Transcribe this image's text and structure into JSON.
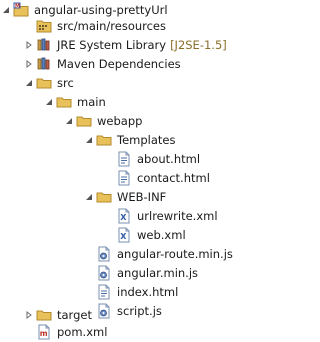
{
  "project_explorer": {
    "project": {
      "label": "angular-using-prettyUrl",
      "icon": "maven-project-icon"
    },
    "items": [
      {
        "label": "src/main/resources",
        "icon": "source-folder-icon",
        "arrow": "none"
      },
      {
        "label": "JRE System Library",
        "decoration": "[J2SE-1.5]",
        "icon": "library-icon",
        "arrow": "collapsed"
      },
      {
        "label": "Maven Dependencies",
        "icon": "library-icon",
        "arrow": "collapsed"
      },
      {
        "label": "src",
        "icon": "folder-icon",
        "arrow": "expanded"
      },
      {
        "label": "main",
        "icon": "folder-icon",
        "arrow": "expanded"
      },
      {
        "label": "webapp",
        "icon": "folder-icon",
        "arrow": "expanded"
      },
      {
        "label": "Templates",
        "icon": "folder-icon",
        "arrow": "expanded"
      },
      {
        "label": "about.html",
        "icon": "html-file-icon",
        "arrow": "none"
      },
      {
        "label": "contact.html",
        "icon": "html-file-icon",
        "arrow": "none"
      },
      {
        "label": "WEB-INF",
        "icon": "folder-icon",
        "arrow": "expanded"
      },
      {
        "label": "urlrewrite.xml",
        "icon": "xml-file-icon",
        "arrow": "none"
      },
      {
        "label": "web.xml",
        "icon": "xml-file-icon",
        "arrow": "none"
      },
      {
        "label": "angular-route.min.js",
        "icon": "js-file-icon",
        "arrow": "none"
      },
      {
        "label": "angular.min.js",
        "icon": "js-file-icon",
        "arrow": "none"
      },
      {
        "label": "index.html",
        "icon": "html-file-icon",
        "arrow": "none"
      },
      {
        "label": "script.js",
        "icon": "js-file-icon",
        "arrow": "none"
      },
      {
        "label": "target",
        "icon": "folder-icon",
        "arrow": "collapsed"
      },
      {
        "label": "pom.xml",
        "icon": "maven-pom-icon",
        "arrow": "none"
      }
    ]
  },
  "colors": {
    "background": "#ffffff",
    "text": "#1a1a1a",
    "decoration": "#8a6f2a",
    "folder": "#e8c15a",
    "arrow": "#6e6e6e"
  }
}
